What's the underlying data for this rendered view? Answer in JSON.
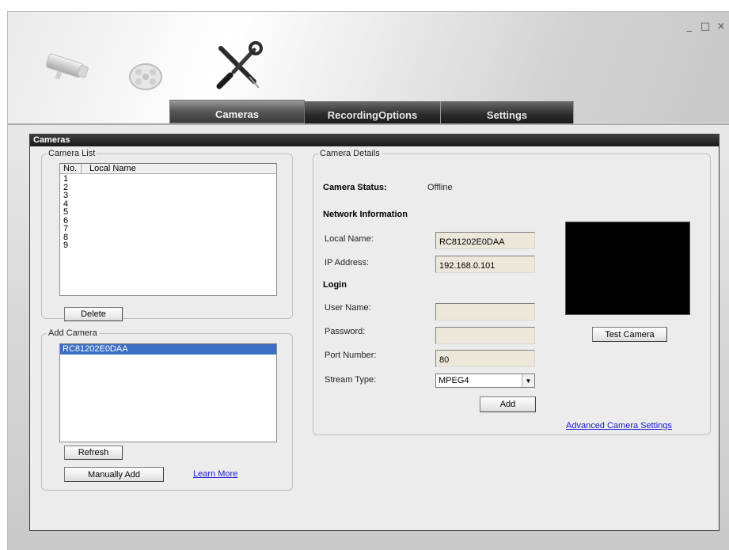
{
  "window": {
    "controls": {
      "minimize": "_",
      "maximize": "□",
      "close": "×"
    }
  },
  "header_icons": [
    "camera-icon",
    "film-reel-icon",
    "tools-icon"
  ],
  "tabs": [
    {
      "label": "Cameras",
      "active": true
    },
    {
      "label": "RecordingOptions",
      "active": false
    },
    {
      "label": "Settings",
      "active": false
    }
  ],
  "panel": {
    "title": "Cameras"
  },
  "camera_list": {
    "legend": "Camera List",
    "columns": [
      "No.",
      "Local Name"
    ],
    "rows": [
      "1",
      "2",
      "3",
      "4",
      "5",
      "6",
      "7",
      "8",
      "9"
    ],
    "delete_label": "Delete"
  },
  "add_camera": {
    "legend": "Add Camera",
    "items": [
      "RC81202E0DAA"
    ],
    "refresh_label": "Refresh",
    "manual_add_label": "Manually Add",
    "learn_more_label": "Learn More"
  },
  "camera_details": {
    "legend": "Camera Details",
    "status_label": "Camera Status:",
    "status_value": "Offline",
    "network_heading": "Network Information",
    "local_name_label": "Local Name:",
    "local_name_value": "RC81202E0DAA",
    "ip_label": "IP Address:",
    "ip_value": "192.168.0.101",
    "login_heading": "Login",
    "username_label": "User Name:",
    "username_value": "",
    "password_label": "Password:",
    "password_value": "",
    "port_label": "Port Number:",
    "port_value": "80",
    "stream_label": "Stream Type:",
    "stream_value": "MPEG4",
    "add_label": "Add",
    "test_camera_label": "Test Camera",
    "advanced_label": "Advanced Camera Settings"
  },
  "colors": {
    "selection": "#3b6fc4",
    "link": "#1a1ad0",
    "field_bg": "#ece7d8",
    "preview_bg": "#000000"
  }
}
